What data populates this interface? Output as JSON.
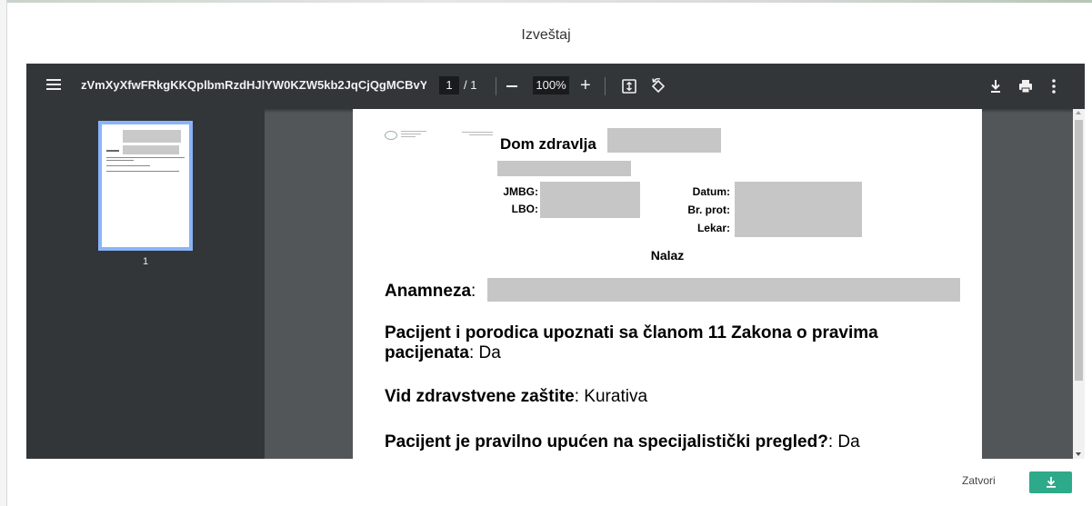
{
  "dialog": {
    "title": "Izveštaj",
    "close_label": "Zatvori",
    "accent_color": "#2daa8a"
  },
  "viewer": {
    "filename": "zVmXyXfwFRkgKKQplbmRzdHJlYW0KZW5kb2JqCjQgMCBvYmoKP...",
    "current_page": "1",
    "page_separator": "/",
    "total_pages": "1",
    "zoom": "100%",
    "zoom_plus": "+",
    "thumbnail_number": "1",
    "icons": [
      "menu-icon",
      "zoom-out-icon",
      "zoom-in-icon",
      "fit-page-icon",
      "rotate-icon",
      "download-icon",
      "print-icon",
      "more-options-icon"
    ]
  },
  "document": {
    "title": "Dom zdravlja",
    "labels": {
      "jmbg": "JMBG:",
      "lbo": "LBO:",
      "datum": "Datum:",
      "br_prot": "Br. prot:",
      "lekar": "Lekar:"
    },
    "section_heading": "Nalaz",
    "anamneza_label": "Anamneza",
    "colon": ":",
    "line1_label": "Pacijent i porodica upoznati sa članom 11 Zakona o pravima",
    "line1_label_cont": "pacijenata",
    "line1_value": ": Da",
    "line2_label": "Vid zdravstvene zaštite",
    "line2_value": ": Kurativa",
    "line3_label": "Pacijent je pravilno upućen na specijalistički pregled?",
    "line3_value": ": Da"
  }
}
